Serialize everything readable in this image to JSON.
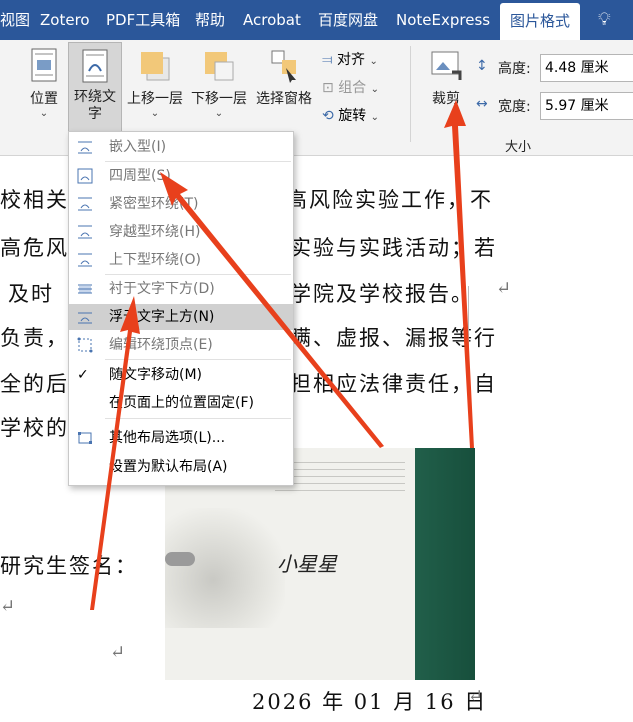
{
  "tabs": [
    {
      "label": "视图"
    },
    {
      "label": "Zotero"
    },
    {
      "label": "PDF工具箱"
    },
    {
      "label": "帮助"
    },
    {
      "label": "Acrobat"
    },
    {
      "label": "百度网盘"
    },
    {
      "label": "NoteExpress"
    },
    {
      "label": "图片格式"
    }
  ],
  "ribbon": {
    "position": "位置",
    "wrap_text_1": "环绕文",
    "wrap_text_2": "字",
    "bring_forward": "上移一层",
    "send_backward": "下移一层",
    "selection_pane": "选择窗格",
    "align": "对齐",
    "group": "组合",
    "rotate": "旋转",
    "crop": "裁剪",
    "height_label": "高度:",
    "height_value": "4.48 厘米",
    "width_label": "宽度:",
    "width_value": "5.97 厘米",
    "size_group": "大小"
  },
  "menu": {
    "inline": "嵌入型(I)",
    "square": "四周型(S)",
    "tight": "紧密型环绕(T)",
    "through": "穿越型环绕(H)",
    "top_bottom": "上下型环绕(O)",
    "behind": "衬于文字下方(D)",
    "front": "浮于文字上方(N)",
    "edit_points": "编辑环绕顶点(E)",
    "move_with_text": "随文字移动(M)",
    "fix_position": "在页面上的位置固定(F)",
    "more_options": "其他布局选项(L)...",
    "set_default": "设置为默认布局(A)"
  },
  "doc": {
    "l1": "校相关",
    "l1r": "高风险实验工作，不",
    "l2": "高危风险",
    "l2r": "实验与实践活动；若",
    "l3": "及时",
    "l3r": "学院及学校报告。",
    "l4": "负责，如",
    "l4r": "瞒、虚报、漏报等行",
    "l5": "全的后",
    "l5r": "担相应法律责任，自",
    "l6": "学校的",
    "sign": "研究生签名：",
    "signature": "小星星",
    "date": "2026 年 01 月 16 日"
  },
  "colors": {
    "title_bar": "#2b579a",
    "ribbon": "#f3f3f3",
    "arrow": "#e8401c",
    "photo_bg": "#1c5e48"
  }
}
